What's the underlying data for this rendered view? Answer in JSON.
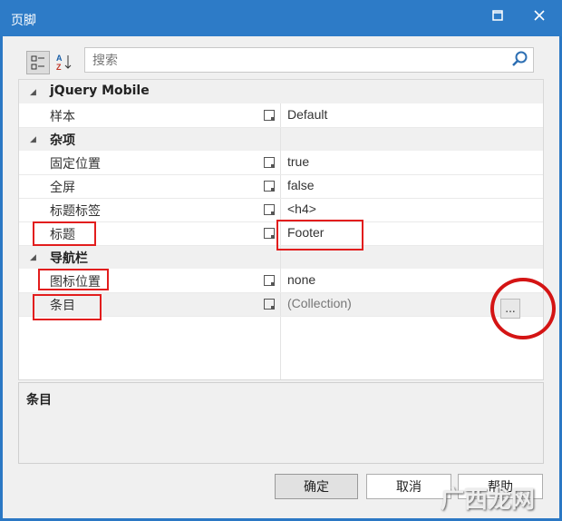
{
  "window": {
    "title": "页脚"
  },
  "toolbar": {
    "search_placeholder": "搜索"
  },
  "grid": {
    "categories": [
      {
        "label": "jQuery Mobile",
        "rows": [
          {
            "name": "样本",
            "value": "Default"
          }
        ]
      },
      {
        "label": "杂项",
        "rows": [
          {
            "name": "固定位置",
            "value": "true"
          },
          {
            "name": "全屏",
            "value": "false"
          },
          {
            "name": "标题标签",
            "value": "<h4>"
          },
          {
            "name": "标题",
            "value": "Footer"
          }
        ]
      },
      {
        "label": "导航栏",
        "rows": [
          {
            "name": "图标位置",
            "value": "none"
          },
          {
            "name": "条目",
            "value": "(Collection)",
            "ellipsis": "..."
          }
        ]
      }
    ]
  },
  "description": {
    "title": "条目"
  },
  "buttons": {
    "ok": "确定",
    "cancel": "取消",
    "help": "帮助"
  },
  "watermark": "广西龙网",
  "colors": {
    "titlebar": "#2d7bc7",
    "annotation": "#e21d1d"
  }
}
